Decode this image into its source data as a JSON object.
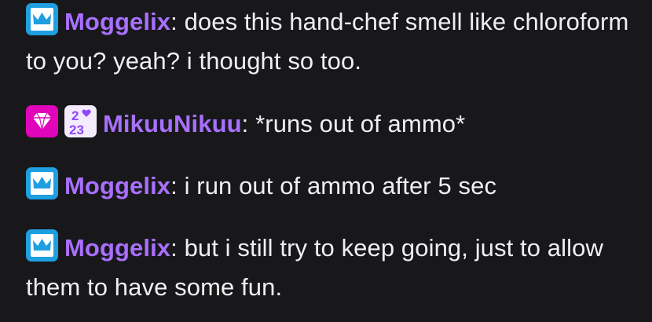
{
  "chat": {
    "messages": [
      {
        "badges": [
          "crown-badge-icon"
        ],
        "username": "Moggelix",
        "username_color": "#a970ff",
        "separator": ":",
        "text": " does this hand-chef smell like chloroform to you? yeah? i thought so too."
      },
      {
        "badges": [
          "gem-badge-icon",
          "year-badge-icon"
        ],
        "year_badge_top": "2",
        "year_badge_bottom": "23",
        "username": "MikuuNikuu",
        "username_color": "#a970ff",
        "separator": ":",
        "text": " *runs out of ammo*"
      },
      {
        "badges": [
          "crown-badge-icon"
        ],
        "username": "Moggelix",
        "username_color": "#a970ff",
        "separator": ":",
        "text": " i run out of ammo after 5 sec"
      },
      {
        "badges": [
          "crown-badge-icon"
        ],
        "username": "Moggelix",
        "username_color": "#a970ff",
        "separator": ":",
        "text": " but i still try to keep going, just to allow them to have some fun."
      }
    ]
  },
  "colors": {
    "background": "#18181b",
    "text": "#efeff1",
    "crown_badge": "#1f9fe0",
    "gem_badge": "#e005b9",
    "year_badge_bg": "#f4ebff",
    "year_badge_text": "#9147ff"
  }
}
